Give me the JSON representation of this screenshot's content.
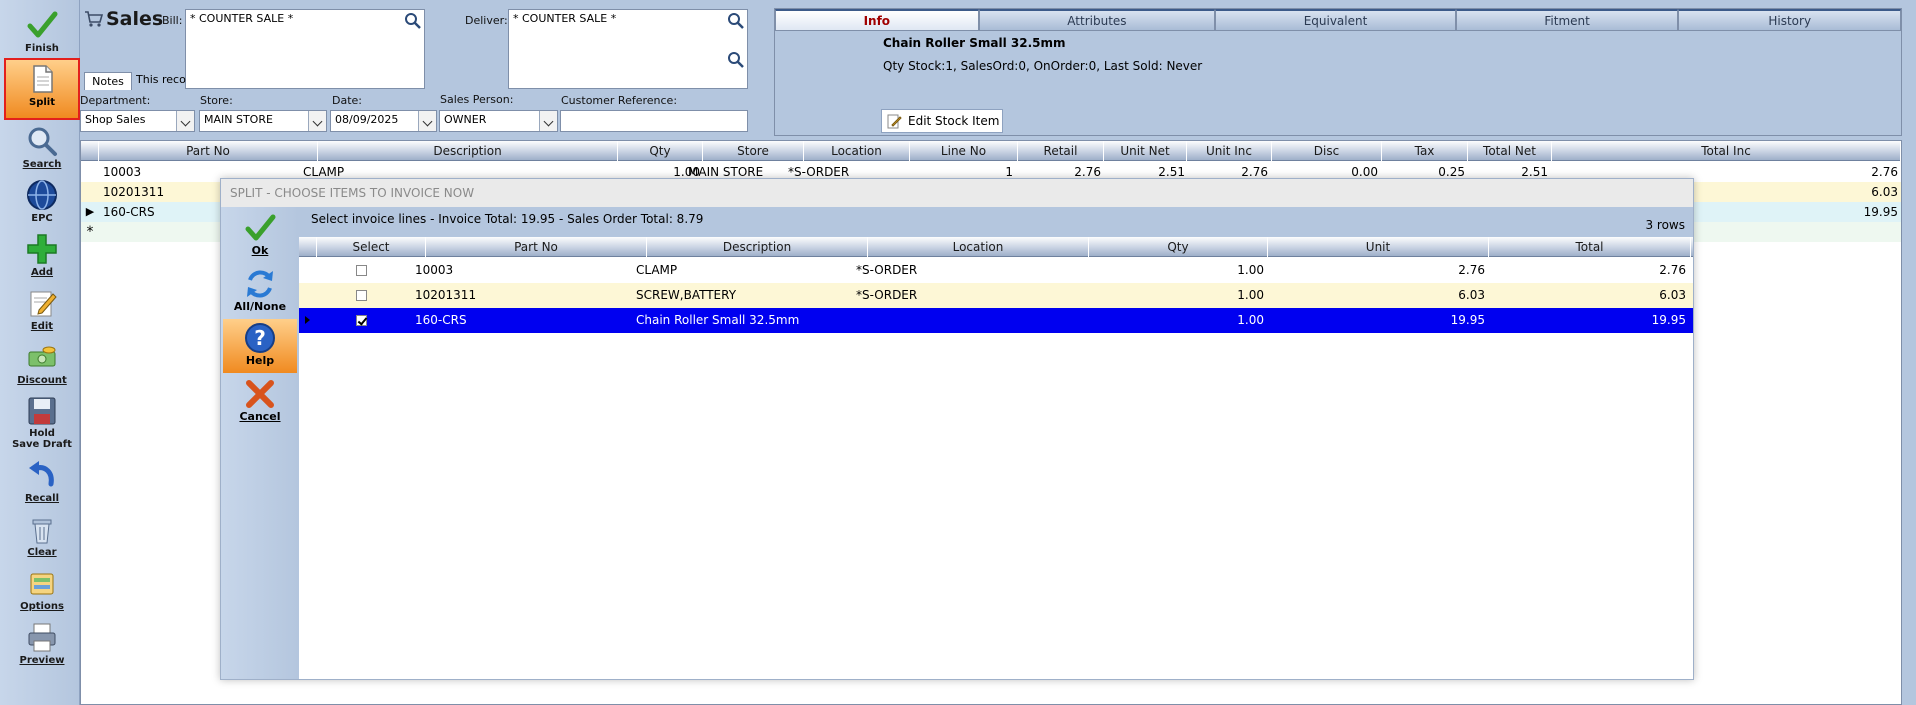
{
  "toolbar": {
    "items": [
      {
        "label": "Finish",
        "icon": "check-icon"
      },
      {
        "label": "Split",
        "icon": "document-icon"
      },
      {
        "label": "Search",
        "icon": "magnifier-icon"
      },
      {
        "label": "EPC",
        "icon": "globe-icon"
      },
      {
        "label": "Add",
        "icon": "plus-icon"
      },
      {
        "label": "Edit",
        "icon": "edit-icon"
      },
      {
        "label": "Discount",
        "icon": "money-icon"
      },
      {
        "label": "Hold",
        "label2": "Save Draft",
        "icon": "floppy-icon"
      },
      {
        "label": "Recall",
        "icon": "recall-arrow-icon"
      },
      {
        "label": "Clear",
        "icon": "trash-icon"
      },
      {
        "label": "Options",
        "icon": "options-icon"
      },
      {
        "label": "Preview",
        "icon": "printer-icon"
      }
    ]
  },
  "header": {
    "title": "Sales",
    "bill_label": "Bill:",
    "bill_value": "* COUNTER SALE *",
    "deliver_label": "Deliver:",
    "deliver_value": "* COUNTER SALE *",
    "notes_tab": "Notes",
    "notes_text": "This recor",
    "department_label": "Department:",
    "department_value": "Shop Sales",
    "store_label": "Store:",
    "store_value": "MAIN STORE",
    "date_label": "Date:",
    "date_value": "08/09/2025",
    "salesperson_label": "Sales Person:",
    "salesperson_value": "OWNER",
    "custref_label": "Customer Reference:",
    "custref_value": ""
  },
  "info_panel": {
    "tabs": [
      "Info",
      "Attributes",
      "Equivalent",
      "Fitment",
      "History"
    ],
    "active_tab": "Info",
    "item_name": "Chain Roller Small 32.5mm",
    "qty_line": "Qty Stock:1, SalesOrd:0, OnOrder:0, Last Sold: Never",
    "edit_button": "Edit Stock Item"
  },
  "main_grid": {
    "columns": [
      "Part No",
      "Description",
      "Qty",
      "Store",
      "Location",
      "Line No",
      "Retail",
      "Unit Net",
      "Unit Inc",
      "Disc",
      "Tax",
      "Total Net",
      "Total Inc"
    ],
    "rows": [
      {
        "part": "10003",
        "desc": "CLAMP",
        "qty": "1.00",
        "store": "MAIN STORE",
        "loc": "*S-ORDER",
        "line": "1",
        "retail": "2.76",
        "unit_net": "2.51",
        "unit_inc": "2.76",
        "disc": "0.00",
        "tax": "0.25",
        "total_net": "2.51",
        "total_inc": "2.76"
      },
      {
        "part": "10201311",
        "total_inc": "6.03"
      },
      {
        "part": "160-CRS",
        "total_inc": "19.95"
      }
    ],
    "new_row_marker": "*"
  },
  "split_dialog": {
    "title": "SPLIT - CHOOSE ITEMS TO INVOICE NOW",
    "message": "Select invoice lines - Invoice Total: 19.95 - Sales Order Total: 8.79",
    "row_count": "3 rows",
    "buttons": [
      {
        "label": "Ok",
        "icon": "check-icon"
      },
      {
        "label": "All/None",
        "icon": "refresh-icon"
      },
      {
        "label": "Help",
        "icon": "help-icon"
      },
      {
        "label": "Cancel",
        "icon": "cancel-icon"
      }
    ],
    "columns": [
      "Select",
      "Part No",
      "Description",
      "Location",
      "Qty",
      "Unit",
      "Total"
    ],
    "rows": [
      {
        "selected": false,
        "part": "10003",
        "desc": "CLAMP",
        "loc": "*S-ORDER",
        "qty": "1.00",
        "unit": "2.76",
        "total": "2.76"
      },
      {
        "selected": false,
        "part": "10201311",
        "desc": "SCREW,BATTERY",
        "loc": "*S-ORDER",
        "qty": "1.00",
        "unit": "6.03",
        "total": "6.03"
      },
      {
        "selected": true,
        "part": "160-CRS",
        "desc": "Chain Roller Small 32.5mm",
        "loc": "",
        "qty": "1.00",
        "unit": "19.95",
        "total": "19.95"
      }
    ]
  }
}
